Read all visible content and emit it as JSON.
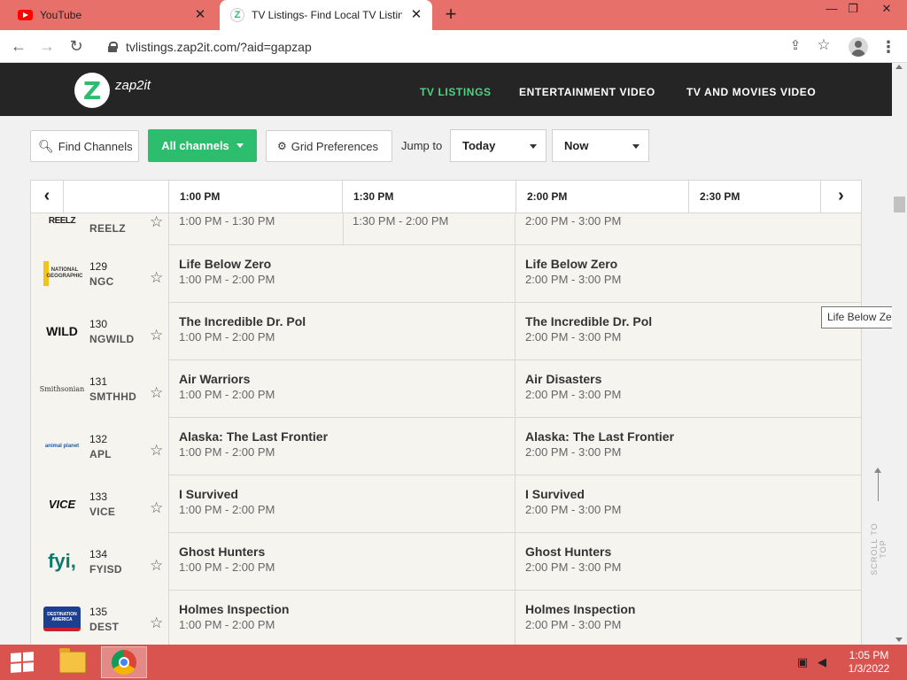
{
  "browser": {
    "tabs": [
      {
        "title": "YouTube"
      },
      {
        "title": "TV Listings- Find Local TV Listings"
      }
    ],
    "url": "tvlistings.zap2it.com/?aid=gapzap"
  },
  "site": {
    "logo_text": "zap2it",
    "nav": [
      "TV LISTINGS",
      "ENTERTAINMENT VIDEO",
      "TV AND MOVIES VIDEO"
    ]
  },
  "controls": {
    "find_channels": "Find Channels",
    "all_channels": "All channels",
    "grid_preferences": "Grid Preferences",
    "jump_to": "Jump to",
    "day": "Today",
    "time": "Now"
  },
  "time_slots": [
    "1:00 PM",
    "1:30 PM",
    "2:00 PM",
    "2:30 PM"
  ],
  "rows": [
    {
      "logo": "REELZ",
      "number": "",
      "call": "REELZ",
      "programs": [
        {
          "title": "",
          "time": "1:00 PM - 1:30 PM"
        },
        {
          "title": "",
          "time": "1:30 PM - 2:00 PM"
        },
        {
          "title": "",
          "time": "2:00 PM - 3:00 PM"
        }
      ]
    },
    {
      "logo": "NATIONAL GEOGRAPHIC",
      "number": "129",
      "call": "NGC",
      "programs": [
        {
          "title": "Life Below Zero",
          "time": "1:00 PM - 2:00 PM"
        },
        {
          "title": "Life Below Zero",
          "time": "2:00 PM - 3:00 PM"
        }
      ]
    },
    {
      "logo": "WILD",
      "number": "130",
      "call": "NGWILD",
      "programs": [
        {
          "title": "The Incredible Dr. Pol",
          "time": "1:00 PM - 2:00 PM"
        },
        {
          "title": "The Incredible Dr. Pol",
          "time": "2:00 PM - 3:00 PM"
        }
      ]
    },
    {
      "logo": "Smithsonian",
      "number": "131",
      "call": "SMTHHD",
      "programs": [
        {
          "title": "Air Warriors",
          "time": "1:00 PM - 2:00 PM"
        },
        {
          "title": "Air Disasters",
          "time": "2:00 PM - 3:00 PM"
        }
      ]
    },
    {
      "logo": "animal planet",
      "number": "132",
      "call": "APL",
      "programs": [
        {
          "title": "Alaska: The Last Frontier",
          "time": "1:00 PM - 2:00 PM"
        },
        {
          "title": "Alaska: The Last Frontier",
          "time": "2:00 PM - 3:00 PM"
        }
      ]
    },
    {
      "logo": "VICE",
      "number": "133",
      "call": "VICE",
      "programs": [
        {
          "title": "I Survived",
          "time": "1:00 PM - 2:00 PM"
        },
        {
          "title": "I Survived",
          "time": "2:00 PM - 3:00 PM"
        }
      ]
    },
    {
      "logo": "fyi,",
      "number": "134",
      "call": "FYISD",
      "programs": [
        {
          "title": "Ghost Hunters",
          "time": "1:00 PM - 2:00 PM"
        },
        {
          "title": "Ghost Hunters",
          "time": "2:00 PM - 3:00 PM"
        }
      ]
    },
    {
      "logo": "DESTINATION AMERICA",
      "number": "135",
      "call": "DEST",
      "programs": [
        {
          "title": "Holmes Inspection",
          "time": "1:00 PM - 2:00 PM"
        },
        {
          "title": "Holmes Inspection",
          "time": "2:00 PM - 3:00 PM"
        }
      ]
    }
  ],
  "tooltip": "Life Below Zero",
  "scroll_to_top": "SCROLL TO TOP",
  "taskbar": {
    "time": "1:05 PM",
    "date": "1/3/2022"
  },
  "colors": {
    "accent_green": "#2dbd6e",
    "nav_active": "#4fd283",
    "header_bg": "#252525",
    "taskbar": "#d9534f"
  }
}
